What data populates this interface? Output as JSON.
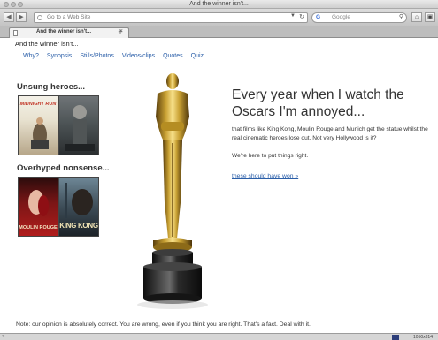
{
  "window": {
    "title": "And the winner isn't..."
  },
  "toolbar": {
    "back_icon": "back-arrow-icon",
    "forward_icon": "forward-arrow-icon",
    "url_placeholder": "Go to a Web Site",
    "search_placeholder": "Google",
    "search_engine_logo": "G",
    "home_icon": "home-icon",
    "bookmark_icon": "bookmark-icon"
  },
  "tabs": [
    {
      "label": "And the winner isn't..."
    }
  ],
  "page": {
    "title": "And the winner isn't...",
    "nav": [
      "Why?",
      "Synopsis",
      "Stills/Photos",
      "Videos/clips",
      "Quotes",
      "Quiz"
    ],
    "unsung_heading": "Unsung heroes...",
    "overhyped_heading": "Overhyped nonsense...",
    "posters": {
      "p1": "MIDNIGHT RUN",
      "p2": "",
      "p3": "MOULIN ROUGE",
      "p4": "KING KONG"
    },
    "hero_heading": "Every year when I watch the Oscars I'm annoyed...",
    "hero_body": "that films like King Kong, Moulin Rouge and Munich get the statue whilst the real cinematic heroes lose out. Not very Hollywood is it?",
    "hero_body2": "We're here to put things right.",
    "link": "these should have won »",
    "footer": "Note: our opinion is absolutely correct. You are wrong, even if you think you are right. That's a fact. Deal with it."
  },
  "statusbar": {
    "left": "«",
    "resolution": "1050x814"
  },
  "colors": {
    "link": "#2a5ea8",
    "statue_gold": "#c9a133",
    "base": "#1e1e1e"
  }
}
